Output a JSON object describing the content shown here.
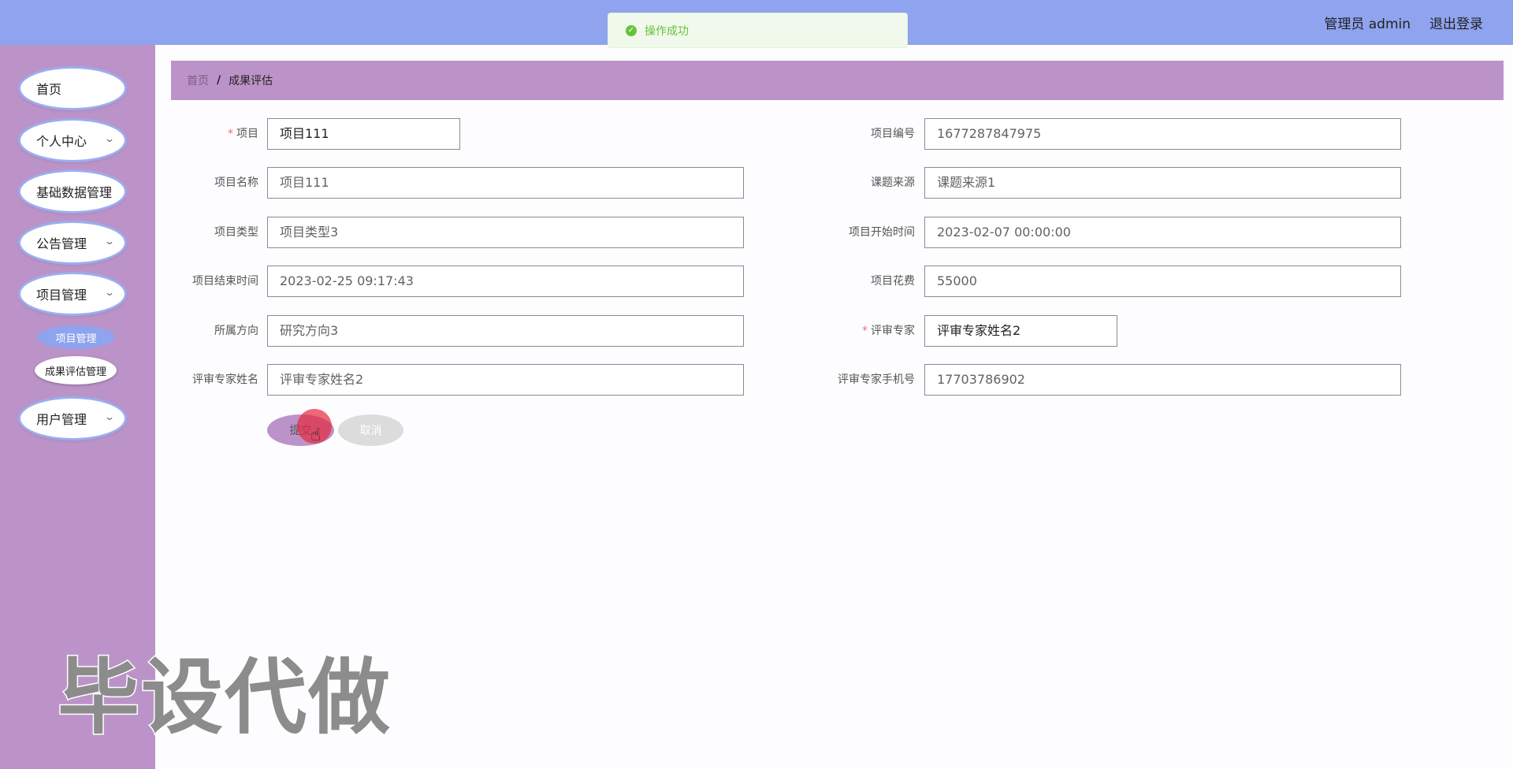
{
  "header": {
    "admin_label": "管理员 admin",
    "logout_label": "退出登录"
  },
  "toast": {
    "message": "操作成功"
  },
  "sidebar": {
    "items": [
      {
        "label": "首页"
      },
      {
        "label": "个人中心"
      },
      {
        "label": "基础数据管理"
      },
      {
        "label": "公告管理"
      },
      {
        "label": "项目管理"
      },
      {
        "label": "用户管理"
      }
    ],
    "sub_items": [
      {
        "label": "项目管理",
        "active": true
      },
      {
        "label": "成果评估管理",
        "active": false
      }
    ]
  },
  "breadcrumb": {
    "home": "首页",
    "separator": "/",
    "current": "成果评估"
  },
  "form": {
    "fields": [
      {
        "label": "项目",
        "value": "项目111",
        "required": true
      },
      {
        "label": "项目编号",
        "value": "1677287847975"
      },
      {
        "label": "项目名称",
        "value": "项目111"
      },
      {
        "label": "课题来源",
        "value": "课题来源1"
      },
      {
        "label": "项目类型",
        "value": "项目类型3"
      },
      {
        "label": "项目开始时间",
        "value": "2023-02-07 00:00:00"
      },
      {
        "label": "项目结束时间",
        "value": "2023-02-25 09:17:43"
      },
      {
        "label": "项目花费",
        "value": "55000"
      },
      {
        "label": "所属方向",
        "value": "研究方向3"
      },
      {
        "label": "评审专家",
        "value": "评审专家姓名2",
        "required": true
      },
      {
        "label": "评审专家姓名",
        "value": "评审专家姓名2"
      },
      {
        "label": "评审专家手机号",
        "value": "17703786902"
      }
    ],
    "required_mark": "*",
    "submit_label": "提交",
    "cancel_label": "取消"
  },
  "watermark": {
    "text": "毕设代做"
  },
  "colors": {
    "topbar": "#8fa3ee",
    "sidebar": "#bc93c8",
    "breadcrumb_bg": "#bc93c8",
    "toast_success": "#67c23a",
    "required": "#f56c6c"
  },
  "icons": {
    "toast": "check-circle-icon",
    "chevron": "chevron-down-icon"
  }
}
